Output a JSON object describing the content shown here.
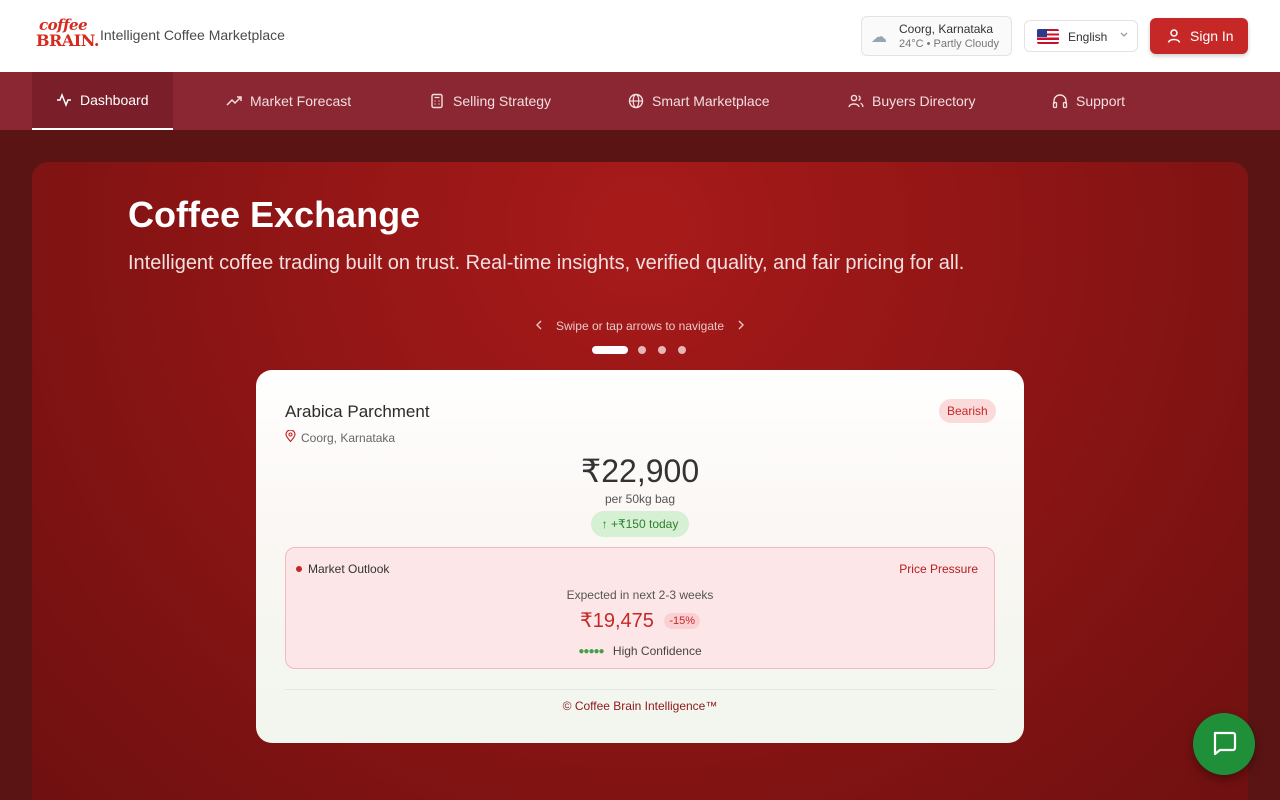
{
  "header": {
    "logo_line1": "coffee",
    "logo_line2": "BRAIN.",
    "tagline": "Intelligent Coffee Marketplace",
    "weather": {
      "icon": "cloud-icon",
      "location": "Coorg, Karnataka",
      "details": "24°C • Partly Cloudy"
    },
    "language": {
      "flag": "us-flag-icon",
      "label": "English"
    },
    "sign_in_label": "Sign In",
    "accent_color": "#c62828"
  },
  "nav": {
    "items": [
      {
        "label": "Dashboard",
        "icon": "activity-icon",
        "active": true
      },
      {
        "label": "Market Forecast",
        "icon": "trending-up-icon",
        "active": false
      },
      {
        "label": "Selling Strategy",
        "icon": "calculator-icon",
        "active": false
      },
      {
        "label": "Smart Marketplace",
        "icon": "globe-icon",
        "active": false
      },
      {
        "label": "Buyers Directory",
        "icon": "users-icon",
        "active": false
      },
      {
        "label": "Support",
        "icon": "headphones-icon",
        "active": false
      }
    ]
  },
  "hero": {
    "title": "Coffee Exchange",
    "subtitle": "Intelligent coffee trading built on trust. Real-time insights, verified quality, and fair pricing for all.",
    "swipe_hint": "Swipe or tap arrows to navigate",
    "carousel": {
      "total_slides": 4,
      "active_index": 0
    }
  },
  "card": {
    "title": "Arabica Parchment",
    "location": "Coorg, Karnataka",
    "trend_badge": "Bearish",
    "price": "₹22,900",
    "unit": "per 50kg bag",
    "change": "+₹150 today",
    "outlook": {
      "label": "Market Outlook",
      "status": "Price Pressure",
      "expected": "Expected in next 2-3 weeks",
      "price": "₹19,475",
      "percent": "-15%",
      "confidence": "High Confidence",
      "confidence_level": 5
    },
    "footer": "© Coffee Brain Intelligence™"
  },
  "chat": {
    "icon": "chat-icon",
    "color": "#1f8f3a"
  }
}
